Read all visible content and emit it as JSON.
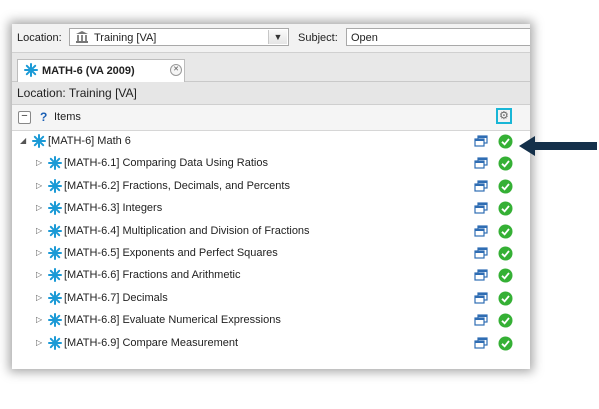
{
  "header": {
    "location_label": "Location:",
    "location_value": "Training [VA]",
    "subject_label": "Subject:",
    "subject_value": "Open"
  },
  "tab": {
    "title": "MATH-6 (VA 2009)"
  },
  "location_line": "Location: Training [VA]",
  "items_bar": {
    "help": "?",
    "label": "Items"
  },
  "tree": {
    "root": {
      "label": "[MATH-6] Math 6",
      "expanded": true
    },
    "children": [
      {
        "label": "[MATH-6.1] Comparing Data Using Ratios"
      },
      {
        "label": "[MATH-6.2] Fractions, Decimals, and Percents"
      },
      {
        "label": "[MATH-6.3] Integers"
      },
      {
        "label": "[MATH-6.4] Multiplication and Division of Fractions"
      },
      {
        "label": "[MATH-6.5] Exponents and Perfect Squares"
      },
      {
        "label": "[MATH-6.6] Fractions and Arithmetic"
      },
      {
        "label": "[MATH-6.7] Decimals"
      },
      {
        "label": "[MATH-6.8] Evaluate Numerical Expressions"
      },
      {
        "label": "[MATH-6.9] Compare Measurement"
      }
    ]
  },
  "colors": {
    "star": "#1b9ad6",
    "check_green": "#35b035",
    "copy_blue": "#2f6db3",
    "highlight_cyan": "#19b6d6",
    "callout_arrow": "#14304a"
  }
}
